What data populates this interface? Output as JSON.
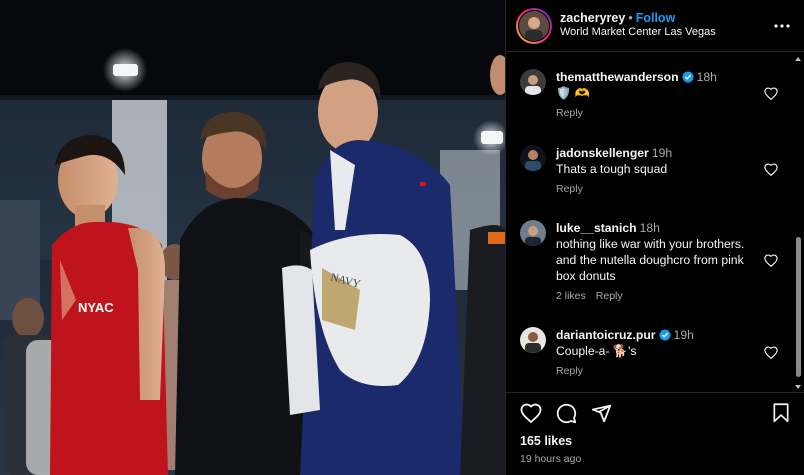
{
  "post": {
    "username": "zacheryrey",
    "separator": "•",
    "follow_label": "Follow",
    "location": "World Market Center Las Vegas",
    "likes": "165 likes",
    "time_ago": "19 hours ago"
  },
  "comments": [
    {
      "username": "thematthewanderson",
      "verified": true,
      "time": "18h",
      "text": "🛡️ 🫶",
      "reply": "Reply",
      "likes": ""
    },
    {
      "username": "jadonskellenger",
      "verified": false,
      "time": "19h",
      "text": "Thats a tough squad",
      "reply": "Reply",
      "likes": ""
    },
    {
      "username": "luke__stanich",
      "verified": false,
      "time": "18h",
      "text": "nothing like war with your brothers. and the nutella doughcro from pink box donuts",
      "reply": "Reply",
      "likes": "2 likes"
    },
    {
      "username": "dariantoicruz.pur",
      "verified": true,
      "time": "19h",
      "text": "Couple-a- 🐕's",
      "reply": "Reply",
      "likes": ""
    }
  ],
  "icons": {
    "more": "more-options-icon",
    "like": "heart-icon",
    "comment": "comment-icon",
    "share": "share-icon",
    "save": "bookmark-icon",
    "verified": "verified-badge-icon"
  },
  "colors": {
    "accent": "#1d9bf0",
    "background": "#000000",
    "muted": "#a8a8a8",
    "singlet": "#c0141c",
    "jacket": "#1b2a6b"
  }
}
